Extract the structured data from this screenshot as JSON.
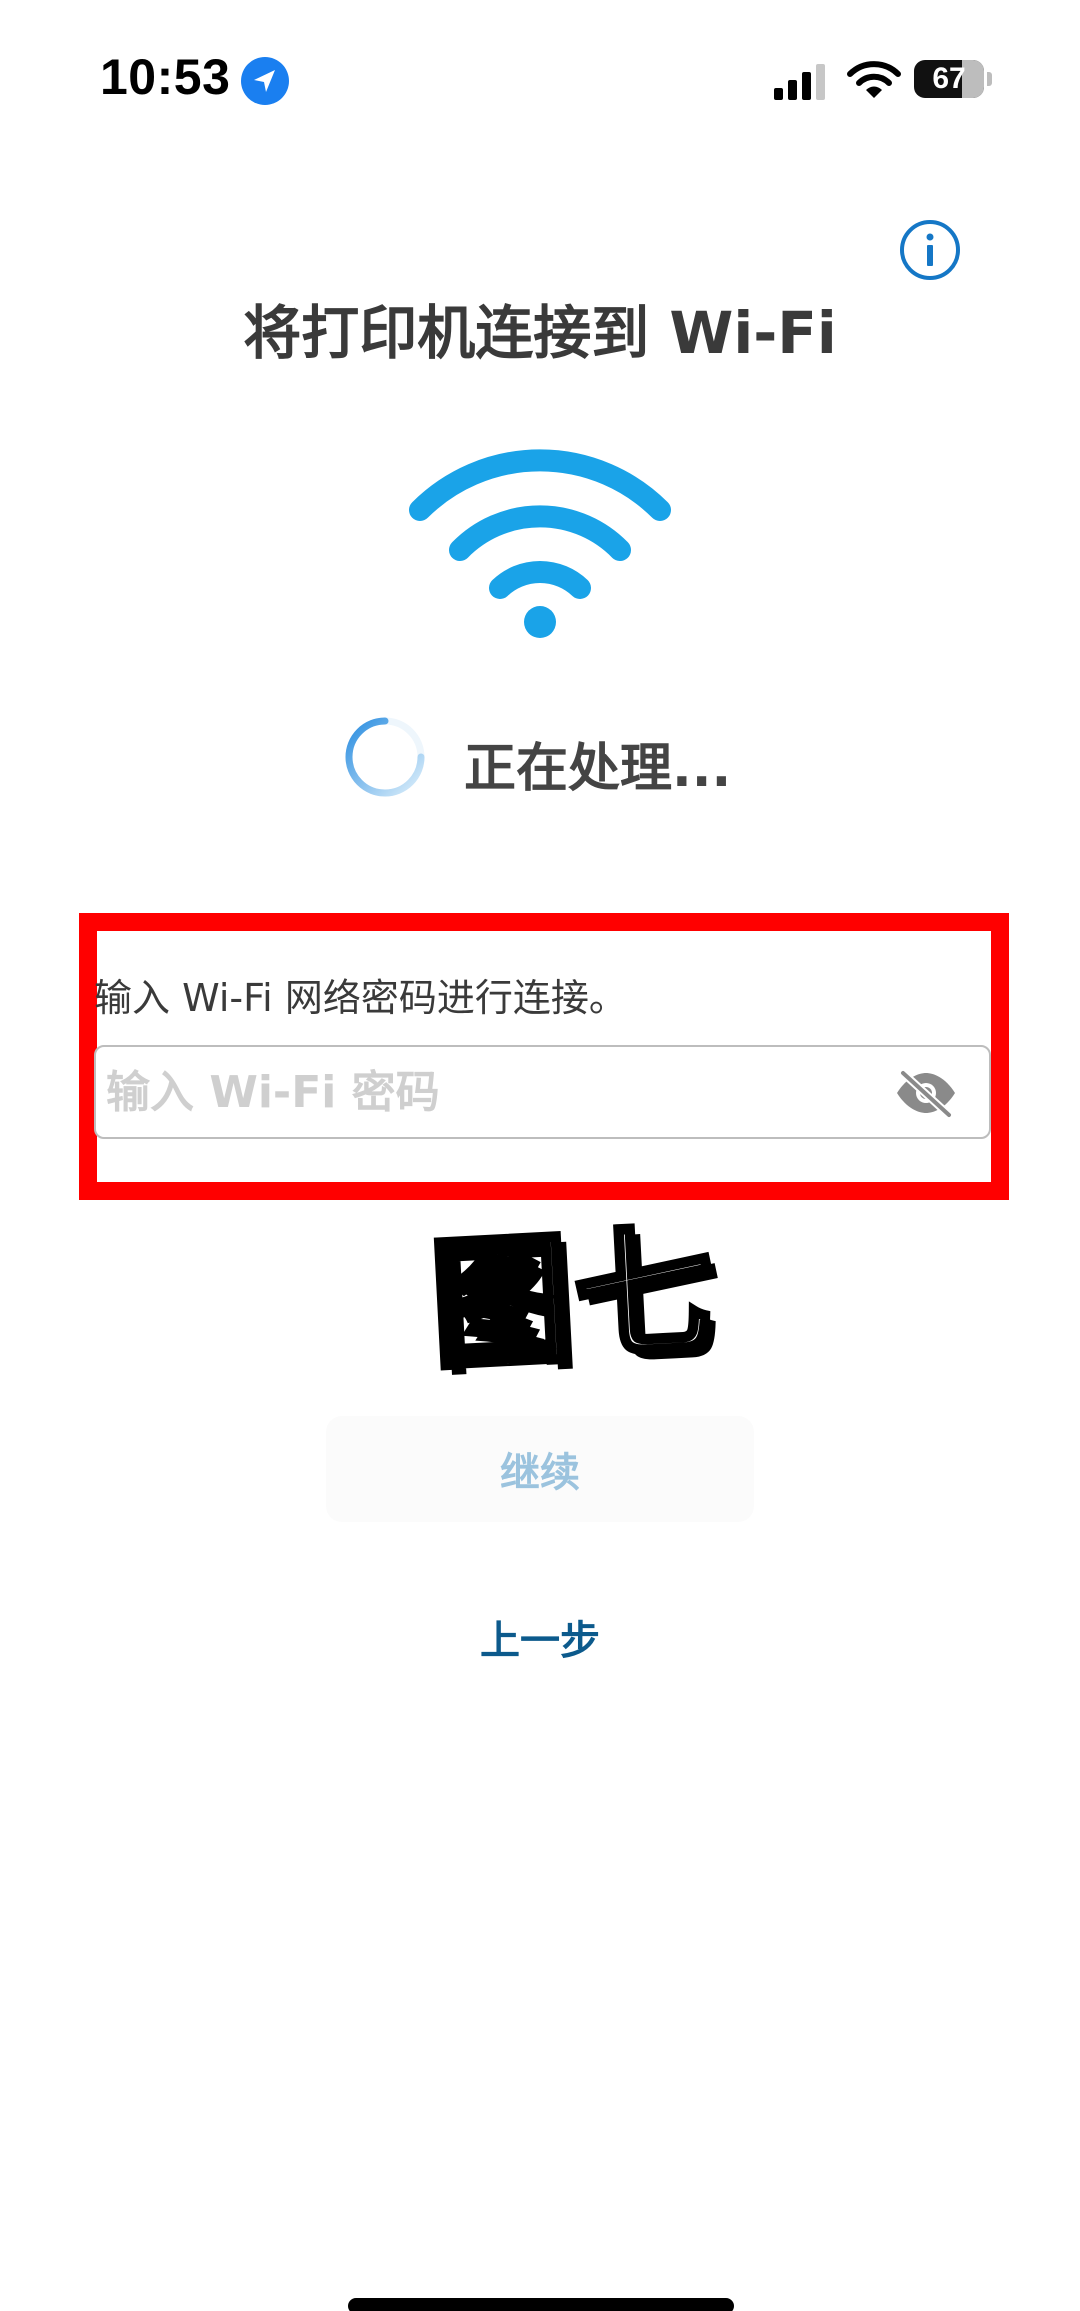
{
  "status_bar": {
    "time": "10:53",
    "battery": "67"
  },
  "page": {
    "title": "将打印机连接到 Wi-Fi",
    "processing_text": "正在处理...",
    "instruction": "输入 Wi-Fi 网络密码进行连接。",
    "password_field": {
      "value": "",
      "placeholder": "输入 Wi-Fi 密码"
    },
    "sticker_caption": "图七",
    "continue_label": "继续",
    "back_label": "上一步"
  },
  "icons": {
    "location": "location-arrow-icon",
    "cellular": "cellular-signal-icon",
    "wifi_status": "wifi-icon",
    "info": "info-icon",
    "wifi_hero": "wifi-icon",
    "spinner": "loading-spinner-icon",
    "password_toggle": "eye-slash-icon"
  },
  "colors": {
    "accent_blue": "#1aa3e8",
    "info_blue": "#1577c6",
    "highlight_red": "#ff0000",
    "link_blue": "#0c5a8c",
    "disabled_button_text": "#9bc3de"
  }
}
